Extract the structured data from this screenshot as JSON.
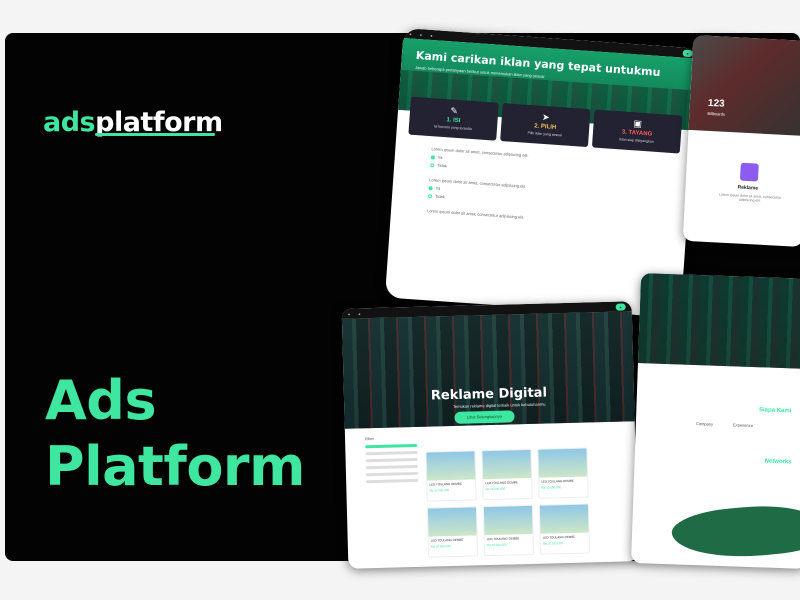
{
  "brand": {
    "name_prefix": "ads",
    "name_suffix": "platform"
  },
  "hero": {
    "line1": "Ads",
    "line2": "Platform"
  },
  "card_survey": {
    "title": "Kami carikan iklan yang tepat untukmu",
    "subtitle": "Jawab beberapa pertanyaan berikut untuk menemukan iklan yang sesuai",
    "steps": [
      {
        "label": "1. ISI",
        "desc": "Isi formulir yang tersedia"
      },
      {
        "label": "2. PILIH",
        "desc": "Pilih iklan yang sesuai"
      },
      {
        "label": "3. TAYANG",
        "desc": "Iklan siap ditayangkan"
      }
    ],
    "question_text": "Lorem ipsum dolor sit amet, consectetur adipiscing elit.",
    "option_yes": "Ya",
    "option_no": "Tidak"
  },
  "card_listing": {
    "title": "Reklame Digital",
    "subtitle": "Temukan reklame digital terbaik untuk kebutuhanmu",
    "cta": "Lihat Selengkapnya",
    "filter_label": "Filter",
    "tile_title": "LED TOULANG DEMBE",
    "tile_price": "Rp 10.000.000"
  },
  "card_stats": {
    "stat": "123",
    "stat_label": "Billboards",
    "item_title": "Reklame",
    "item_desc": "Lorem ipsum dolor sit amet, consectetur adipiscing elit."
  },
  "card_network": {
    "section_title": "Siapa Kami",
    "feature1": "Company",
    "feature2": "Experience",
    "networks_title": "Networks"
  },
  "colors": {
    "accent": "#3ee6a0",
    "background": "#030303"
  }
}
